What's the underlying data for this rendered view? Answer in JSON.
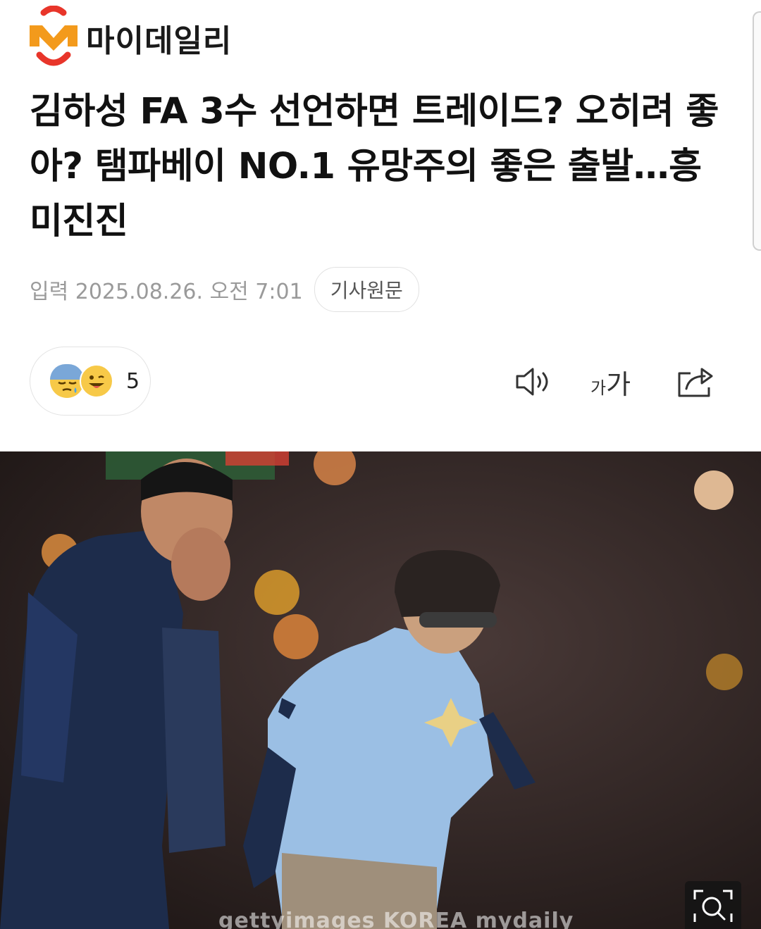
{
  "brand": {
    "name": "마이데일리",
    "logo_letter": "M"
  },
  "article": {
    "headline": "김하성 FA 3수 선언하면 트레이드? 오히려 좋아? 탬파베이 NO.1 유망주의 좋은 출발…흥미진진",
    "published": "입력 2025.08.26. 오전 7:01",
    "source_button": "기사원문"
  },
  "reactions": {
    "count": "5",
    "icons": [
      "sleepy-sweat-emoji",
      "tongue-wink-emoji"
    ]
  },
  "toolbar": {
    "audio_icon": "speaker-icon",
    "font_size_label_small": "가",
    "font_size_label_large": "가",
    "share_icon": "share-icon"
  },
  "photo": {
    "description_icon": "zoom-icon",
    "watermark": "gettyimages KOREA mydaily"
  },
  "colors": {
    "logo_orange": "#f39a1c",
    "logo_red": "#e8352a",
    "text": "#111111",
    "meta": "#9a9a9a"
  }
}
